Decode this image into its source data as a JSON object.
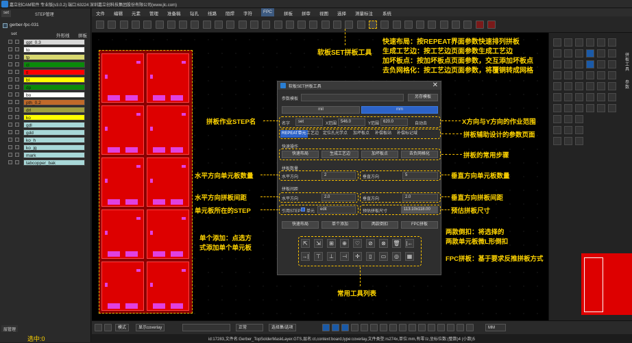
{
  "title_bar": {
    "text": "嘉立创CAM软件 专业版(v3.0.2) 端口:63224    深圳嘉立创科技集团股份有限公司(www.jlc.com)"
  },
  "left_panel": {
    "tabs": [
      "set",
      "STEP管理"
    ],
    "job_name": "gerber-fpc-031",
    "layer_header": {
      "name": "set",
      "col1": "外形线",
      "col2": "拼板"
    },
    "layers": [
      {
        "name": "gpt_0.3",
        "color": "#d8d8d8"
      },
      {
        "name": "to",
        "color": "#ffffff"
      },
      {
        "name": "tp",
        "color": "#d8d870"
      },
      {
        "name": "cl",
        "color": "#0a8a0a"
      },
      {
        "name": "tl",
        "color": "#ff0000"
      },
      {
        "name": "bl",
        "color": "#ffff00"
      },
      {
        "name": "dp",
        "color": "#0a8a0a"
      },
      {
        "name": "bo",
        "color": "#ffffff"
      },
      {
        "name": "pth_0.2",
        "color": "#c06a2a"
      },
      {
        "name": "drl",
        "color": "#a0a040"
      },
      {
        "name": "ko",
        "color": "#ffff00"
      },
      {
        "name": "gdl",
        "color": "#a8d8d8"
      },
      {
        "name": "gdd",
        "color": "#a8d8d8"
      },
      {
        "name": "ko_h",
        "color": "#a8d8d8"
      },
      {
        "name": "ko_jg",
        "color": "#a8d8d8"
      },
      {
        "name": "mark",
        "color": "#a8d8d8"
      },
      {
        "name": "tabcopper_bak",
        "color": "#a8d8d8"
      }
    ],
    "bottom_button": "层管理",
    "selected_status": "选中:0"
  },
  "menu": [
    "文件",
    "编辑",
    "元素",
    "管理",
    "准备稿",
    "钻孔",
    "线路",
    "阻焊",
    "字符",
    "FPC",
    "拼板",
    "拼审",
    "视图",
    "选择",
    "测量标注",
    "系统"
  ],
  "menu_active": "FPC",
  "dialog": {
    "title": "软板SET拼板工具",
    "param_label": "参数模板",
    "save_template": "另存模板",
    "unit_mil": "mil",
    "unit_mm": "mm",
    "name_label": "名字",
    "name_value": "set",
    "x_label": "X范围",
    "x_value": "546.0",
    "y_label": "Y范围",
    "y_value": "620.0",
    "auto_label": "自动去",
    "tabs": [
      "REPEAT单元",
      "工艺边",
      "定位孔光学点",
      "加坏板点",
      "补偿板站",
      "补偿标记域"
    ],
    "quick_ops_label": "快速操作",
    "quick_ops": [
      "快速布局",
      "生成工艺边",
      "加坏板点",
      "去负网格化"
    ],
    "count_label": "拼板数量",
    "h_dir": "水平方向",
    "h_count": "2",
    "v_dir": "垂直方向",
    "v_count": "5",
    "gap_label": "拼板间距",
    "h_gap": "2.0",
    "v_gap": "2.0",
    "ref_step_label": "引用STEP",
    "ref_check": "单元",
    "ref_step_value": "edit",
    "est_label": "预估拼板尺寸",
    "est_value": "113.10x118.00",
    "actions": [
      "快速布局",
      "单个添加",
      "两款倒扣",
      "FPC拼板"
    ],
    "tools_row1": [
      "⇱",
      "⇲",
      "⊞",
      "⊕",
      "♡",
      "⊘",
      "⊗",
      "🗑",
      "|←"
    ],
    "tools_row2": [
      "→|",
      "⊤",
      "⊥",
      "⊣",
      "✛",
      "▯",
      "▭",
      "◎",
      "▦"
    ]
  },
  "annotations": {
    "toolbar_tool": "软板SET拼板工具",
    "quick_layout": "快速布局：按REPEAT界面参数快速排列拼板",
    "gen_edge": "生成工艺边：按工艺边页面参数生成工艺边",
    "add_bad": "加坏板点：按加坏板点页面参数，交互添加坏板点",
    "remove_grid": "去负网格化：按工艺边页面参数，将覆铜转成网格",
    "step_name": "拼板作业STEP名",
    "xy_range": "X方向与Y方向的作业范围",
    "param_pages": "拼板辅助设计的参数页面",
    "common_steps": "拼板的常用步骤",
    "h_count": "水平方向单元板数量",
    "v_count": "垂直方向单元板数量",
    "h_gap": "水平方向拼板间距",
    "v_gap": "垂直方向拼板间距",
    "unit_step": "单元板所在的STEP",
    "est_size": "预估拼板尺寸",
    "single_add_1": "单个添加：点选方",
    "single_add_2": "式添加单个单元板",
    "flip_1": "两款倒扣：将选择的",
    "flip_2": "两款单元板微L形倒扣",
    "fpc": "FPC拼板：基于要求反推拼板方式",
    "tools": "常用工具列表"
  },
  "bottom_bar": {
    "mode": "模式",
    "normal": "正常",
    "units": "MM",
    "coverlay": "显示coverlay",
    "select_mode": "选择集/选项"
  },
  "status_bar": {
    "text": "id:17283,文件名:Gerber_TopSolderMaskLayer.GTS,层名:ct,context:board,type:coverlay,文件类型:rs274x,单位:mm,有零:lz,坐标位数:(整数)4 (小数)5"
  },
  "right_panel": {
    "vtext1": "拼板工具",
    "vtext2": "参数"
  }
}
